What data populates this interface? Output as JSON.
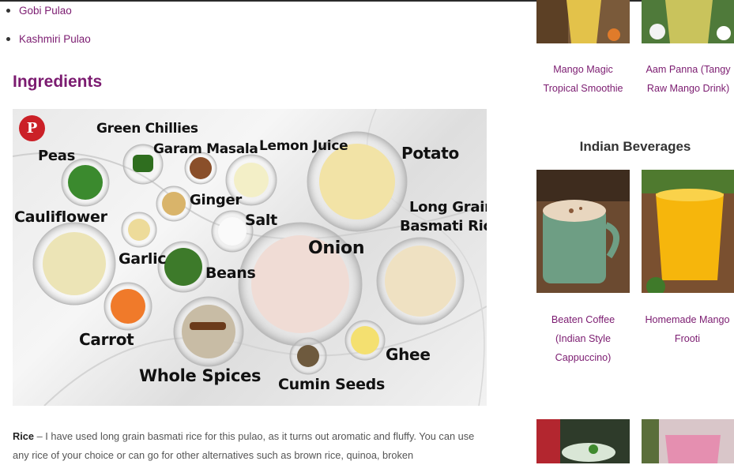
{
  "related_links": [
    "Gobi Pulao",
    "Kashmiri Pulao"
  ],
  "section_heading": "Ingredients",
  "pin_glyph": "P",
  "ingredient_labels": [
    "Green Chillies",
    "Garam Masala",
    "Lemon Juice",
    "Potato",
    "Peas",
    "Ginger",
    "Long Grain",
    "Basmati Rice",
    "Salt",
    "Cauliflower",
    "Onion",
    "Garlic",
    "Beans",
    "Carrot",
    "Ghee",
    "Whole Spices",
    "Cumin Seeds"
  ],
  "paragraph": {
    "term": "Rice",
    "text": " – I have used long grain basmati rice for this pulao, as it turns out aromatic and fluffy. You can use any rice of your choice or can go for other alternatives such as brown rice, quinoa, broken"
  },
  "sidebar": {
    "top_cards": [
      {
        "line1": "Mango Magic",
        "line2": "Tropical Smoothie"
      },
      {
        "line1": "Aam Panna (Tangy",
        "line2": "Raw Mango Drink)"
      }
    ],
    "heading": "Indian Beverages",
    "beverage_cards": [
      {
        "line1": "Beaten Coffee",
        "line2": "(Indian Style",
        "line3": "Cappuccino)"
      },
      {
        "line1": "Homemade Mango",
        "line2": "Frooti"
      }
    ]
  },
  "colors": {
    "link": "#7b1b70",
    "pinterest": "#cb2027",
    "text": "#555555"
  },
  "icons": [
    "pinterest-icon",
    "bullet-dot"
  ]
}
